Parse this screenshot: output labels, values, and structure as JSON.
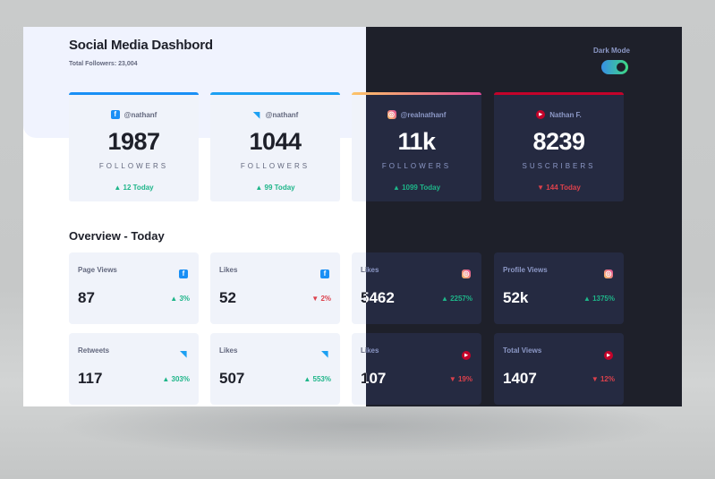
{
  "header": {
    "title": "Social Media Dashbord",
    "total_followers": "Total Followers: 23,004",
    "dark_mode_label": "Dark Mode",
    "dark_mode_on": true
  },
  "colors": {
    "facebook": "#198ff5",
    "twitter": "#1ca0f2",
    "instagram_start": "#fdc468",
    "instagram_end": "#df4996",
    "youtube": "#c4032a",
    "up": "#1eb589",
    "down": "#dc414c"
  },
  "cards": [
    {
      "platform": "facebook",
      "icon": "facebook-icon",
      "handle": "@nathanf",
      "count": "1987",
      "label": "FOLLOWERS",
      "change": "12 Today",
      "direction": "up"
    },
    {
      "platform": "twitter",
      "icon": "twitter-icon",
      "handle": "@nathanf",
      "count": "1044",
      "label": "FOLLOWERS",
      "change": "99 Today",
      "direction": "up"
    },
    {
      "platform": "instagram",
      "icon": "instagram-icon",
      "handle": "@realnathanf",
      "count": "11k",
      "label": "FOLLOWERS",
      "change": "1099 Today",
      "direction": "up"
    },
    {
      "platform": "youtube",
      "icon": "youtube-icon",
      "handle": "Nathan F.",
      "count": "8239",
      "label": "SUSCRIBERS",
      "change": "144 Today",
      "direction": "down"
    }
  ],
  "overview": {
    "title": "Overview - Today",
    "items": [
      {
        "label": "Page Views",
        "platform": "facebook",
        "value": "87",
        "change": "3%",
        "direction": "up"
      },
      {
        "label": "Likes",
        "platform": "facebook",
        "value": "52",
        "change": "2%",
        "direction": "down"
      },
      {
        "label": "Likes",
        "platform": "instagram",
        "value": "5462",
        "change": "2257%",
        "direction": "up"
      },
      {
        "label": "Profile Views",
        "platform": "instagram",
        "value": "52k",
        "change": "1375%",
        "direction": "up"
      },
      {
        "label": "Retweets",
        "platform": "twitter",
        "value": "117",
        "change": "303%",
        "direction": "up"
      },
      {
        "label": "Likes",
        "platform": "twitter",
        "value": "507",
        "change": "553%",
        "direction": "up"
      },
      {
        "label": "Likes",
        "platform": "youtube",
        "value": "107",
        "change": "19%",
        "direction": "down"
      },
      {
        "label": "Total Views",
        "platform": "youtube",
        "value": "1407",
        "change": "12%",
        "direction": "down"
      }
    ]
  }
}
